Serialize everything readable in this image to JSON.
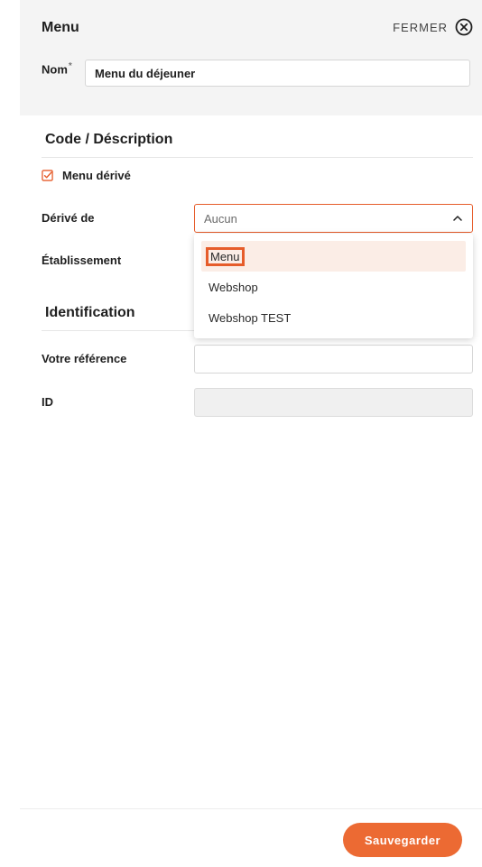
{
  "panel": {
    "title": "Menu",
    "close_label": "FERMER"
  },
  "name_field": {
    "label": "Nom",
    "required_mark": "*",
    "value": "Menu du déjeuner"
  },
  "section_code": {
    "title": "Code / Déscription",
    "derived_checkbox": {
      "label": "Menu dérivé",
      "checked": true
    },
    "derived_from": {
      "label": "Dérivé de",
      "selected": "Aucun",
      "options": [
        "Menu",
        "Webshop",
        "Webshop TEST"
      ],
      "highlighted_option": "Menu"
    },
    "establishment": {
      "label": "Établissement"
    }
  },
  "section_identification": {
    "title": "Identification",
    "reference": {
      "label": "Votre référence",
      "value": ""
    },
    "id": {
      "label": "ID",
      "value": ""
    }
  },
  "footer": {
    "save_label": "Sauvegarder"
  },
  "colors": {
    "accent": "#ec6a33",
    "header_bg": "#f4f4f4"
  }
}
